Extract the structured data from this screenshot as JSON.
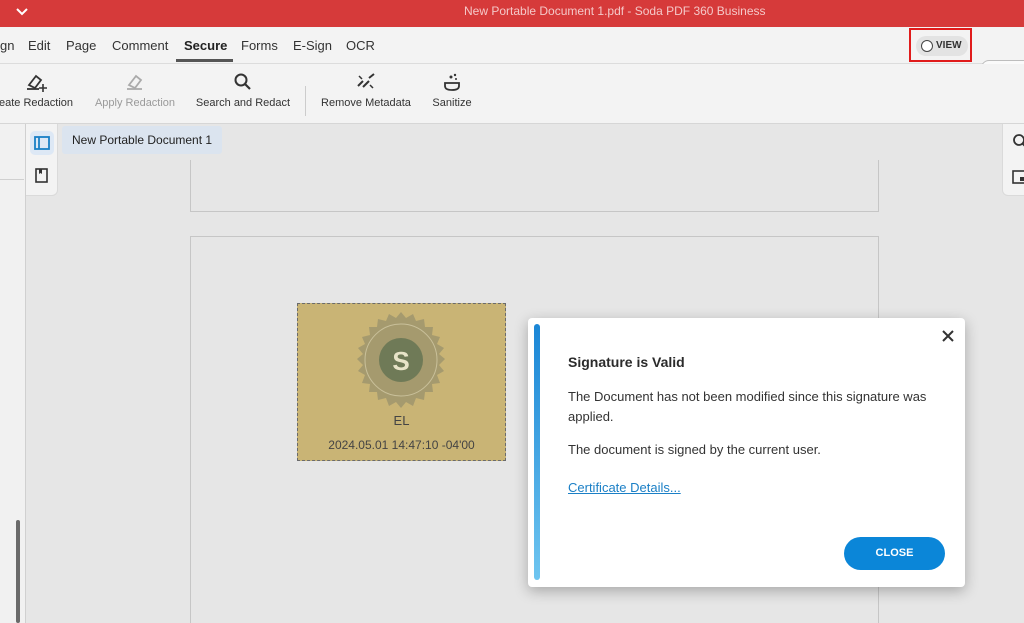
{
  "window": {
    "title": "New Portable Document 1.pdf  -  Soda PDF 360 Business"
  },
  "menu": {
    "items": [
      {
        "label": "gn",
        "active": false
      },
      {
        "label": "Edit",
        "active": false
      },
      {
        "label": "Page",
        "active": false
      },
      {
        "label": "Comment",
        "active": false
      },
      {
        "label": "Secure",
        "active": true
      },
      {
        "label": "Forms",
        "active": false
      },
      {
        "label": "E-Sign",
        "active": false
      },
      {
        "label": "OCR",
        "active": false
      }
    ],
    "view_label": "VIEW"
  },
  "toolbar": {
    "create_redaction": "eate Redaction",
    "apply_redaction": "Apply Redaction",
    "search_and_redact": "Search and Redact",
    "remove_metadata": "Remove Metadata",
    "sanitize": "Sanitize"
  },
  "document": {
    "tab_label": "New Portable Document 1",
    "signature": {
      "seal_letter": "S",
      "name": "EL",
      "date": "2024.05.01 14:47:10 -04'00"
    }
  },
  "dialog": {
    "title": "Signature is Valid",
    "message_1": "The Document has not been modified since this signature was applied.",
    "message_2": "The document is signed by the current user.",
    "link_label": "Certificate Details...",
    "close_button": "CLOSE"
  },
  "colors": {
    "titlebar": "#d63a3a",
    "accent_blue": "#0b86d8",
    "signature_bg": "#c9b475",
    "highlight_red": "#e01b1b"
  }
}
